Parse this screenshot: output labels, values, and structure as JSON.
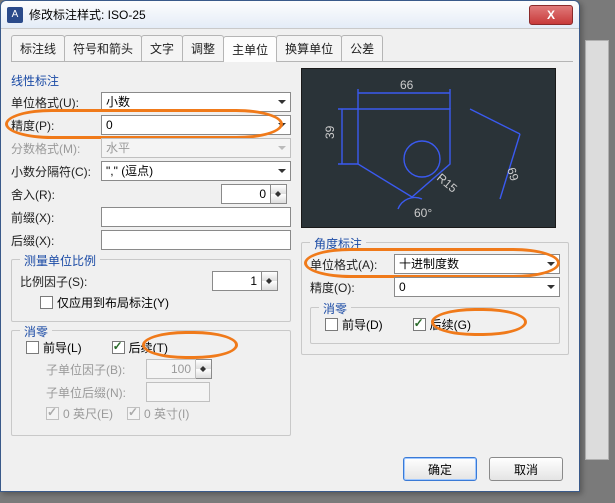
{
  "window": {
    "title": "修改标注样式: ISO-25",
    "close": "X"
  },
  "tabs": [
    "标注线",
    "符号和箭头",
    "文字",
    "调整",
    "主单位",
    "换算单位",
    "公差"
  ],
  "active_tab": 4,
  "linear": {
    "title": "线性标注",
    "unit_format_lbl": "单位格式(U):",
    "unit_format_val": "小数",
    "precision_lbl": "精度(P):",
    "precision_val": "0",
    "fraction_lbl": "分数格式(M):",
    "fraction_val": "水平",
    "dec_sep_lbl": "小数分隔符(C):",
    "dec_sep_val": "\",\" (逗点)",
    "round_lbl": "舍入(R):",
    "round_val": "0",
    "prefix_lbl": "前缀(X):",
    "prefix_val": "",
    "suffix_lbl": "后缀(X):",
    "suffix_val": ""
  },
  "scale": {
    "title": "测量单位比例",
    "factor_lbl": "比例因子(S):",
    "factor_val": "1",
    "layout_only_lbl": "仅应用到布局标注(Y)"
  },
  "suppress_lin": {
    "title": "消零",
    "leading_lbl": "前导(L)",
    "trailing_lbl": "后续(T)",
    "sub_factor_lbl": "子单位因子(B):",
    "sub_factor_val": "100",
    "sub_suffix_lbl": "子单位后缀(N):",
    "sub_suffix_val": "",
    "feet_lbl": "0 英尺(E)",
    "inch_lbl": "0 英寸(I)"
  },
  "angular": {
    "title": "角度标注",
    "unit_format_lbl": "单位格式(A):",
    "unit_format_val": "十进制度数",
    "precision_lbl": "精度(O):",
    "precision_val": "0"
  },
  "suppress_ang": {
    "title": "消零",
    "leading_lbl": "前导(D)",
    "trailing_lbl": "后续(G)"
  },
  "preview_dim": "66",
  "buttons": {
    "ok": "确定",
    "cancel": "取消"
  }
}
